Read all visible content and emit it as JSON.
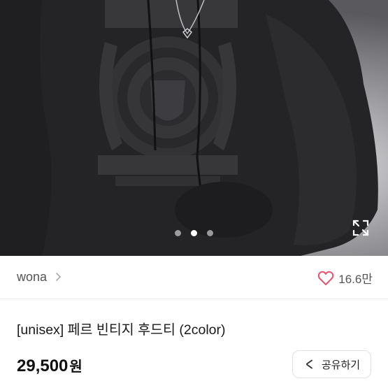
{
  "gallery": {
    "image_alt": "black vintage hoodie photo",
    "page_dots": 3,
    "active_dot": 2
  },
  "shop": {
    "name": "wona",
    "likes": "16.6만",
    "heart_icon": "heart-outline-icon",
    "heart_color": "#e0576f"
  },
  "product": {
    "title": "[unisex] 페르 빈티지 후드티 (2color)",
    "price": "29,500",
    "currency": "원"
  },
  "actions": {
    "share_label": "공유하기",
    "share_icon": "share-icon",
    "expand_icon": "expand-icon"
  }
}
